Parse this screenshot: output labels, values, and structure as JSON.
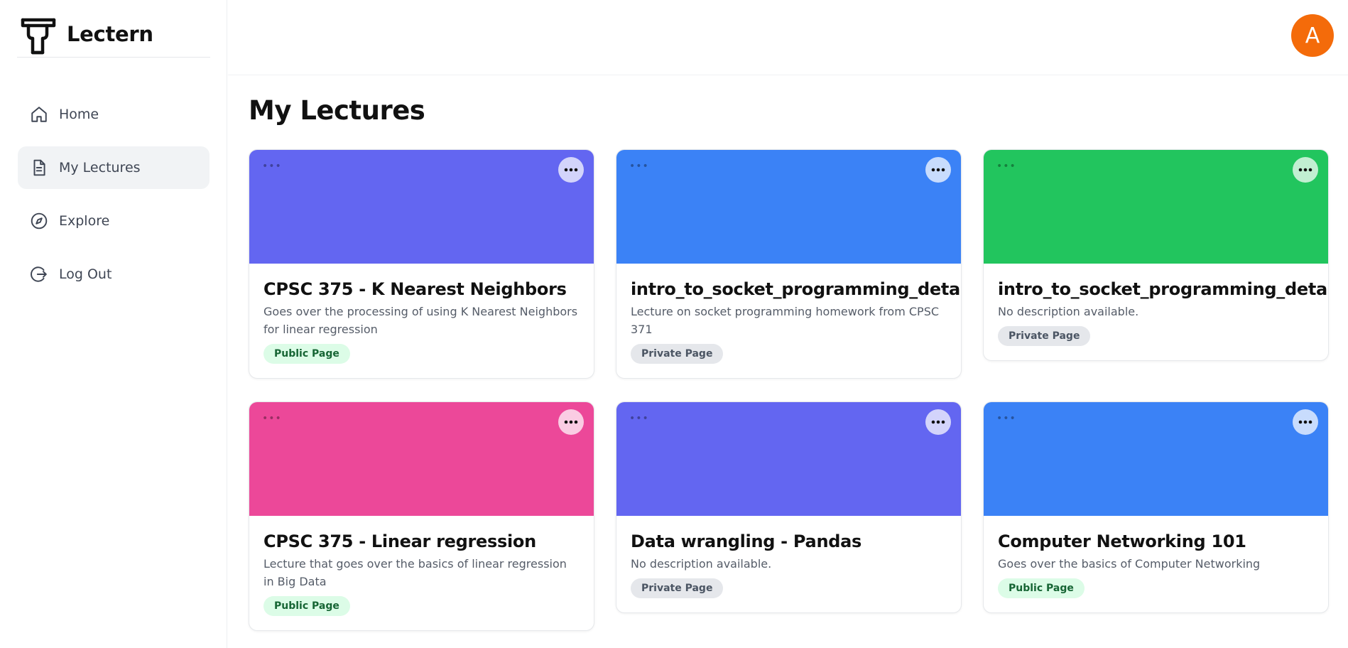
{
  "app": {
    "name": "Lectern"
  },
  "sidebar": {
    "items": [
      {
        "label": "Home",
        "icon": "home-icon",
        "active": false
      },
      {
        "label": "My Lectures",
        "icon": "document-icon",
        "active": true
      },
      {
        "label": "Explore",
        "icon": "compass-icon",
        "active": false
      },
      {
        "label": "Log Out",
        "icon": "logout-icon",
        "active": false
      }
    ]
  },
  "user": {
    "avatar_letter": "A",
    "avatar_color": "#f46b0a"
  },
  "page": {
    "title": "My Lectures"
  },
  "lectures": [
    {
      "title": "CPSC 375 - K Nearest Neighbors",
      "description": "Goes over the processing of using K Nearest Neighbors for linear regression",
      "visibility": "Public Page",
      "color": "#6366f1"
    },
    {
      "title": "intro_to_socket_programming_detailed",
      "description": "Lecture on socket programming homework from CPSC 371",
      "visibility": "Private Page",
      "color": "#3b82f6"
    },
    {
      "title": "intro_to_socket_programming_detailed",
      "description": "No description available.",
      "visibility": "Private Page",
      "color": "#22c55e"
    },
    {
      "title": "CPSC 375 - Linear regression",
      "description": "Lecture that goes over the basics of linear regression in Big Data",
      "visibility": "Public Page",
      "color": "#ec4899"
    },
    {
      "title": "Data wrangling - Pandas",
      "description": "No description available.",
      "visibility": "Private Page",
      "color": "#6366f1"
    },
    {
      "title": "Computer Networking 101",
      "description": "Goes over the basics of Computer Networking",
      "visibility": "Public Page",
      "color": "#3b82f6"
    }
  ]
}
